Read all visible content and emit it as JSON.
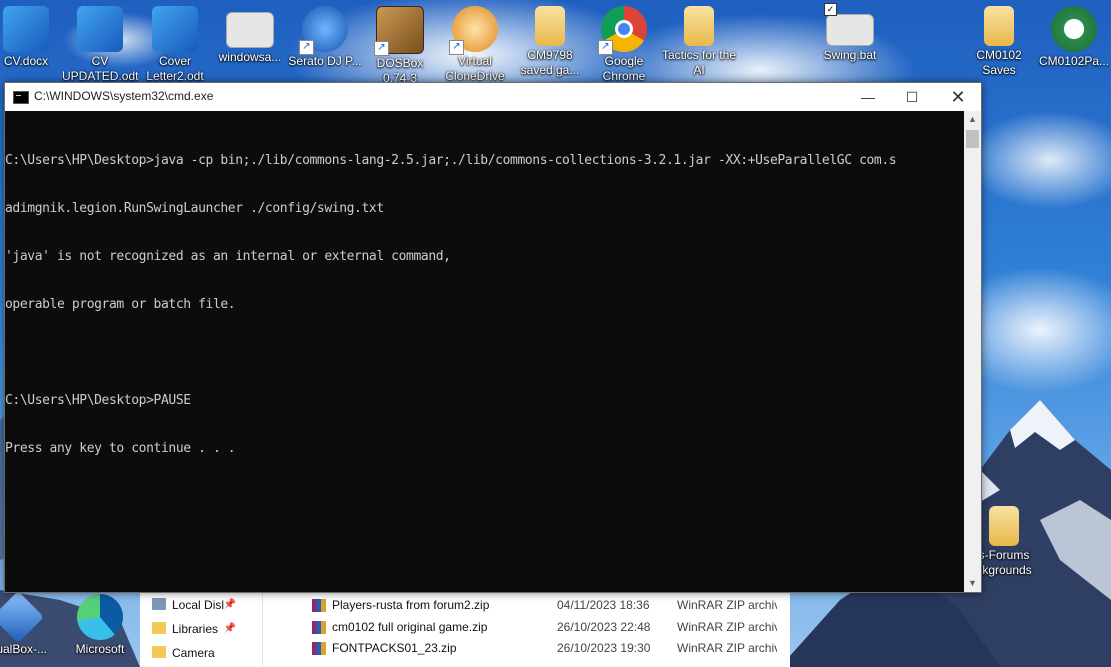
{
  "desktop_icons": [
    {
      "label": "CV.docx",
      "icon": "word-document-icon",
      "color": "#2b7cd3"
    },
    {
      "label": "CV UPDATED.odt",
      "icon": "word-document-icon",
      "color": "#2b7cd3"
    },
    {
      "label": "Cover Letter2.odt",
      "icon": "word-document-icon",
      "color": "#2b7cd3"
    },
    {
      "label": "windowsa...",
      "icon": "settings-file-icon",
      "color": "#d9d9d9"
    },
    {
      "label": "Serato DJ P...",
      "icon": "serato-app-icon",
      "color": "#1f6fd0"
    },
    {
      "label": "DOSBox 0.74-3",
      "icon": "dosbox-app-icon",
      "color": "#8a5a2b"
    },
    {
      "label": "Virtual CloneDrive",
      "icon": "sheep-app-icon",
      "color": "#f0a030"
    },
    {
      "label": "CM9798 saved ga...",
      "icon": "folder-icon",
      "color": "#f3d37a"
    },
    {
      "label": "Google Chrome",
      "icon": "chrome-icon",
      "color": "#db4437"
    },
    {
      "label": "Tactics for the AI",
      "icon": "folder-icon",
      "color": "#f3d37a"
    },
    {
      "label": "Swing.bat",
      "icon": "batch-file-icon",
      "color": "#d9d9d9"
    },
    {
      "label": "CM0102 Saves",
      "icon": "folder-icon",
      "color": "#f3d37a"
    },
    {
      "label": "CM0102Pa...",
      "icon": "soccer-ball-icon",
      "color": "#2a8a4a"
    }
  ],
  "side_icons": [
    {
      "label": "s-Forums ckgrounds",
      "icon": "folder-icon"
    },
    {
      "label": "rtualBox-...",
      "icon": "virtualbox-icon"
    },
    {
      "label": "Microsoft",
      "icon": "edge-icon"
    }
  ],
  "cmd": {
    "title": "C:\\WINDOWS\\system32\\cmd.exe",
    "lines": [
      "C:\\Users\\HP\\Desktop>java -cp bin;./lib/commons-lang-2.5.jar;./lib/commons-collections-3.2.1.jar -XX:+UseParallelGC com.s",
      "adimgnik.legion.RunSwingLauncher ./config/swing.txt",
      "'java' is not recognized as an internal or external command,",
      "operable program or batch file.",
      "",
      "C:\\Users\\HP\\Desktop>PAUSE",
      "Press any key to continue . . ."
    ],
    "bg_color": "#0c0c0c",
    "text_color": "#cccccc"
  },
  "explorer": {
    "nav": [
      {
        "label": "Local Disl",
        "icon": "drive-icon",
        "pinned": true
      },
      {
        "label": "Libraries",
        "icon": "folder-icon",
        "pinned": true
      },
      {
        "label": "Camera",
        "icon": "folder-icon",
        "pinned": false
      }
    ],
    "files": [
      {
        "name": "Players-rusta from forum2.zip",
        "date": "04/11/2023 18:36",
        "type": "WinRAR ZIP archiv"
      },
      {
        "name": "cm0102 full original game.zip",
        "date": "26/10/2023 22:48",
        "type": "WinRAR ZIP archiv"
      },
      {
        "name": "FONTPACKS01_23.zip",
        "date": "26/10/2023 19:30",
        "type": "WinRAR ZIP archiv"
      }
    ]
  }
}
